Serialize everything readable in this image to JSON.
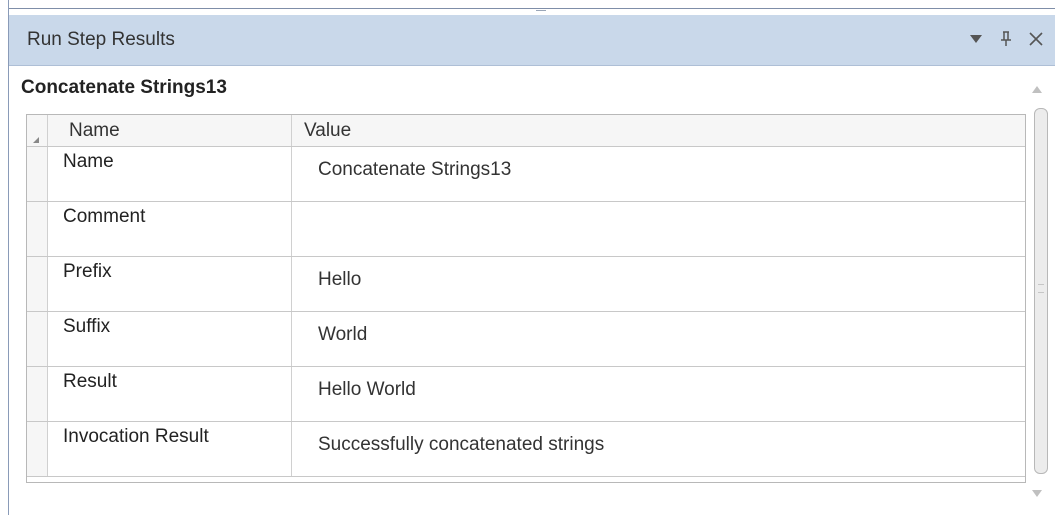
{
  "panel": {
    "title": "Run Step Results",
    "buttons": {
      "menu_icon": "dropdown-triangle-icon",
      "pin_icon": "pin-icon",
      "close_icon": "close-icon"
    }
  },
  "section": {
    "heading": "Concatenate Strings13"
  },
  "table": {
    "columns": [
      "Name",
      "Value"
    ],
    "rows": [
      {
        "name": "Name",
        "value": "Concatenate Strings13"
      },
      {
        "name": "Comment",
        "value": ""
      },
      {
        "name": "Prefix",
        "value": "Hello"
      },
      {
        "name": "Suffix",
        "value": "World"
      },
      {
        "name": "Result",
        "value": "Hello World"
      },
      {
        "name": "Invocation Result",
        "value": "Successfully concatenated strings"
      }
    ]
  },
  "colors": {
    "titlebar_bg": "#c9d8ea",
    "grid_border": "#b8b8b8"
  }
}
